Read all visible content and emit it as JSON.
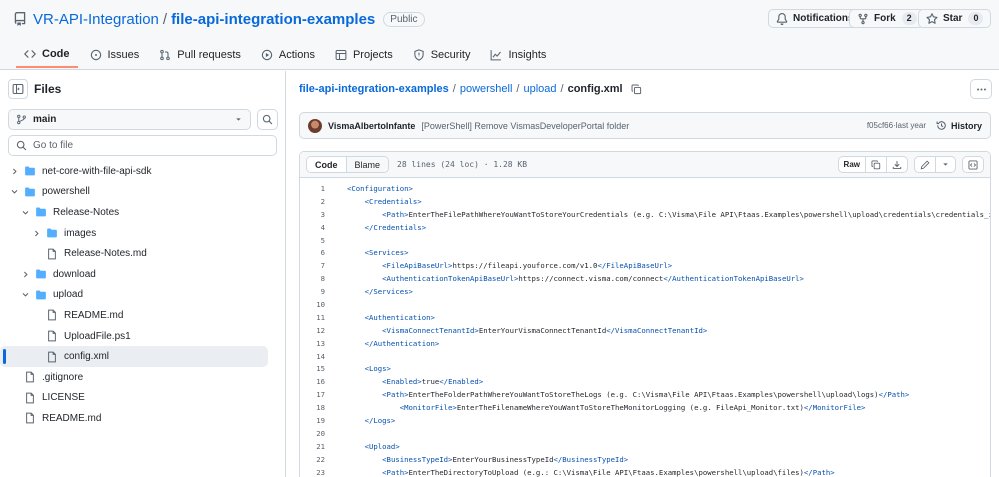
{
  "header": {
    "owner": "VR-API-Integration",
    "separator": "/",
    "repo": "file-api-integration-examples",
    "visibility": "Public",
    "notifications_label": "Notifications",
    "fork_label": "Fork",
    "fork_count": "2",
    "star_label": "Star",
    "star_count": "0"
  },
  "tabs": [
    {
      "label": "Code",
      "icon": "code-icon",
      "active": true
    },
    {
      "label": "Issues",
      "icon": "issue-icon"
    },
    {
      "label": "Pull requests",
      "icon": "pull-request-icon"
    },
    {
      "label": "Actions",
      "icon": "play-icon"
    },
    {
      "label": "Projects",
      "icon": "table-icon"
    },
    {
      "label": "Security",
      "icon": "shield-icon"
    },
    {
      "label": "Insights",
      "icon": "graph-icon"
    }
  ],
  "sidebar": {
    "title": "Files",
    "branch": "main",
    "goto_placeholder": "Go to file",
    "tree": [
      {
        "label": "net-core-with-file-api-sdk",
        "type": "folder",
        "depth": 0,
        "expanded": false
      },
      {
        "label": "powershell",
        "type": "folder",
        "depth": 0,
        "expanded": true
      },
      {
        "label": "Release-Notes",
        "type": "folder",
        "depth": 1,
        "expanded": true
      },
      {
        "label": "images",
        "type": "folder",
        "depth": 2,
        "expanded": false
      },
      {
        "label": "Release-Notes.md",
        "type": "file",
        "depth": 2
      },
      {
        "label": "download",
        "type": "folder",
        "depth": 1,
        "expanded": false
      },
      {
        "label": "upload",
        "type": "folder",
        "depth": 1,
        "expanded": true
      },
      {
        "label": "README.md",
        "type": "file",
        "depth": 2
      },
      {
        "label": "UploadFile.ps1",
        "type": "file",
        "depth": 2
      },
      {
        "label": "config.xml",
        "type": "file",
        "depth": 2,
        "selected": true
      },
      {
        "label": ".gitignore",
        "type": "file",
        "depth": 0
      },
      {
        "label": "LICENSE",
        "type": "file",
        "depth": 0
      },
      {
        "label": "README.md",
        "type": "file",
        "depth": 0
      }
    ]
  },
  "breadcrumb": {
    "repo": "file-api-integration-examples",
    "sep": "/",
    "dir1": "powershell",
    "dir2": "upload",
    "file": "config.xml"
  },
  "commit": {
    "author": "VismaAlbertoInfante",
    "message": "[PowerShell] Remove VismasDeveloperPortal folder",
    "sha": "f05cf66",
    "dot": " · ",
    "time": "last year",
    "history_label": "History"
  },
  "file": {
    "code_tab": "Code",
    "blame_tab": "Blame",
    "meta": "28 lines (24 loc) · 1.28 KB",
    "raw_label": "Raw"
  },
  "code_lines": [
    {
      "n": "1",
      "indent": "",
      "open": "<Configuration>",
      "text": "",
      "close": ""
    },
    {
      "n": "2",
      "indent": "    ",
      "open": "<Credentials>",
      "text": "",
      "close": ""
    },
    {
      "n": "3",
      "indent": "        ",
      "open": "<Path>",
      "text": "EnterTheFilePathWhereYouWantToStoreYourCredentials (e.g. C:\\Visma\\File API\\Ftaas.Examples\\powershell\\upload\\credentials\\credentials_integ",
      "close": ""
    },
    {
      "n": "4",
      "indent": "    ",
      "open": "</Credentials>",
      "text": "",
      "close": ""
    },
    {
      "n": "5",
      "indent": "",
      "open": "",
      "text": "",
      "close": ""
    },
    {
      "n": "6",
      "indent": "    ",
      "open": "<Services>",
      "text": "",
      "close": ""
    },
    {
      "n": "7",
      "indent": "        ",
      "open": "<FileApiBaseUrl>",
      "text": "https://fileapi.youforce.com/v1.0",
      "close": "</FileApiBaseUrl>"
    },
    {
      "n": "8",
      "indent": "        ",
      "open": "<AuthenticationTokenApiBaseUrl>",
      "text": "https://connect.visma.com/connect",
      "close": "</AuthenticationTokenApiBaseUrl>"
    },
    {
      "n": "9",
      "indent": "    ",
      "open": "</Services>",
      "text": "",
      "close": ""
    },
    {
      "n": "10",
      "indent": "",
      "open": "",
      "text": "",
      "close": ""
    },
    {
      "n": "11",
      "indent": "    ",
      "open": "<Authentication>",
      "text": "",
      "close": ""
    },
    {
      "n": "12",
      "indent": "        ",
      "open": "<VismaConnectTenantId>",
      "text": "EnterYourVismaConnectTenantId",
      "close": "</VismaConnectTenantId>"
    },
    {
      "n": "13",
      "indent": "    ",
      "open": "</Authentication>",
      "text": "",
      "close": ""
    },
    {
      "n": "14",
      "indent": "",
      "open": "",
      "text": "",
      "close": ""
    },
    {
      "n": "15",
      "indent": "    ",
      "open": "<Logs>",
      "text": "",
      "close": ""
    },
    {
      "n": "16",
      "indent": "        ",
      "open": "<Enabled>",
      "text": "true",
      "close": "</Enabled>"
    },
    {
      "n": "17",
      "indent": "        ",
      "open": "<Path>",
      "text": "EnterTheFolderPathWhereYouWantToStoreTheLogs (e.g. C:\\Visma\\File API\\Ftaas.Examples\\powershell\\upload\\logs)",
      "close": "</Path>"
    },
    {
      "n": "18",
      "indent": "            ",
      "open": "<MonitorFile>",
      "text": "EnterTheFilenameWhereYouWantToStoreTheMonitorLogging (e.g. FileApi_Monitor.txt)",
      "close": "</MonitorFile>"
    },
    {
      "n": "19",
      "indent": "    ",
      "open": "</Logs>",
      "text": "",
      "close": ""
    },
    {
      "n": "20",
      "indent": "",
      "open": "",
      "text": "",
      "close": ""
    },
    {
      "n": "21",
      "indent": "    ",
      "open": "<Upload>",
      "text": "",
      "close": ""
    },
    {
      "n": "22",
      "indent": "        ",
      "open": "<BusinessTypeId>",
      "text": "EnterYourBusinessTypeId",
      "close": "</BusinessTypeId>"
    },
    {
      "n": "23",
      "indent": "        ",
      "open": "<Path>",
      "text": "EnterTheDirectoryToUpload (e.g.: C:\\Visma\\File API\\Ftaas.Examples\\powershell\\upload\\files)",
      "close": "</Path>"
    }
  ],
  "colors": {
    "link": "#0969da",
    "xml_tag": "#0550ae",
    "active_tab_underline": "#fd8c73",
    "folder": "#54aeff"
  }
}
